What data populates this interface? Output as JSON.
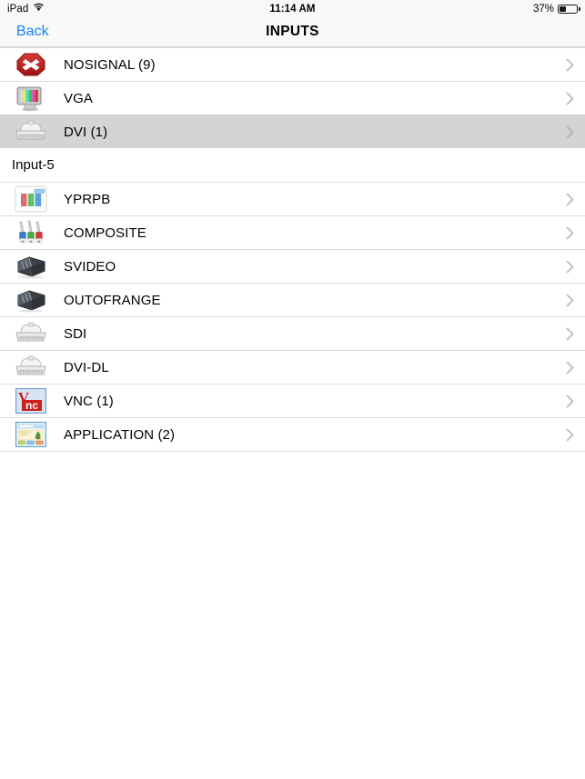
{
  "status_bar": {
    "device": "iPad",
    "wifi_icon": "wifi-icon",
    "time": "11:14 AM",
    "battery_percent": "37%",
    "battery_level": 37,
    "battery_icon": "battery-icon"
  },
  "nav_bar": {
    "back_label": "Back",
    "back_color": "#1783e8",
    "title": "INPUTS"
  },
  "section_header": {
    "label": "Input-5"
  },
  "colors": {
    "selected_row": "#d4d4d4",
    "separator": "#dcdcdc",
    "chevron": "#c2c2c2",
    "text": "#000000"
  },
  "list": {
    "group_top": [
      {
        "label": "NOSIGNAL (9)",
        "icon": "no-signal-icon",
        "selected": false
      },
      {
        "label": "VGA",
        "icon": "vga-monitor-icon",
        "selected": false
      },
      {
        "label": "DVI (1)",
        "icon": "dvi-connector-icon",
        "selected": true
      }
    ],
    "group_bottom": [
      {
        "label": "YPRPB",
        "icon": "component-bars-icon",
        "selected": false
      },
      {
        "label": "COMPOSITE",
        "icon": "rca-cables-icon",
        "selected": false
      },
      {
        "label": "SVIDEO",
        "icon": "dark-connector-icon",
        "selected": false
      },
      {
        "label": "OUTOFRANGE",
        "icon": "dark-connector-icon",
        "selected": false
      },
      {
        "label": "SDI",
        "icon": "white-connector-icon",
        "selected": false
      },
      {
        "label": "DVI-DL",
        "icon": "white-connector-icon",
        "selected": false
      },
      {
        "label": "VNC (1)",
        "icon": "vnc-logo-icon",
        "selected": false
      },
      {
        "label": "APPLICATION (2)",
        "icon": "application-window-icon",
        "selected": false
      }
    ]
  },
  "chevron_glyph": "›"
}
